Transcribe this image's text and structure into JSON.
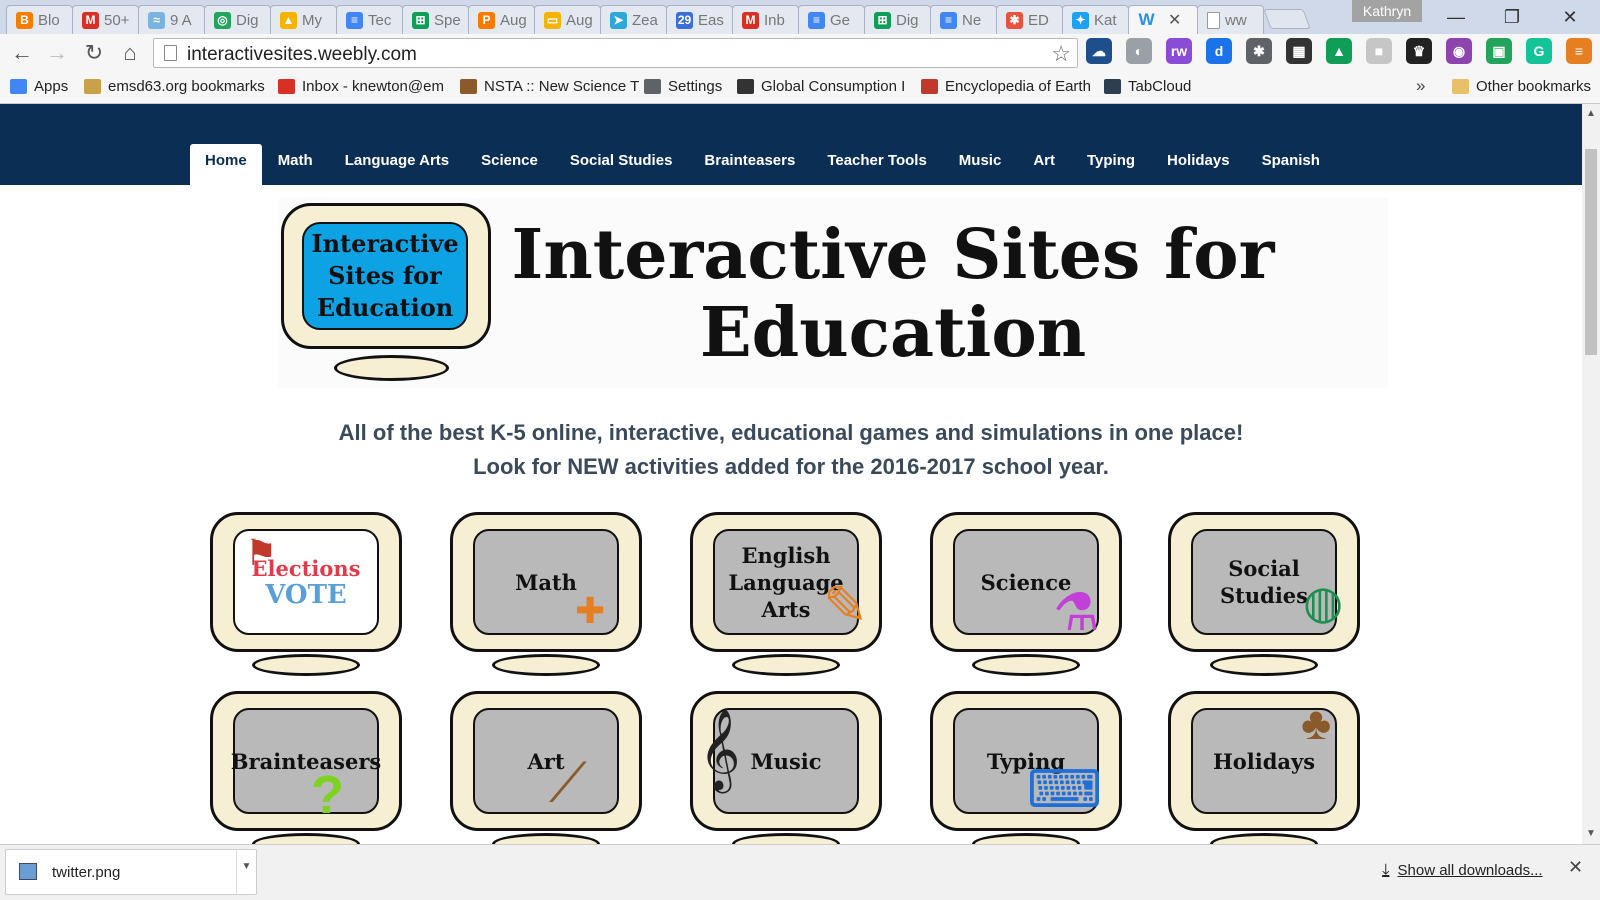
{
  "browser": {
    "tabs": [
      {
        "label": "Blo",
        "icon": "blogger-icon",
        "color": "#f57d00",
        "glyph": "B"
      },
      {
        "label": "50+",
        "icon": "gmail-icon",
        "color": "#d93025",
        "glyph": "M"
      },
      {
        "label": "9 A",
        "icon": "cloud-app-icon",
        "color": "#7ab3e0",
        "glyph": "≈"
      },
      {
        "label": "Dig",
        "icon": "classroom-icon",
        "color": "#22a45d",
        "glyph": "◎"
      },
      {
        "label": "My",
        "icon": "google-drive-icon",
        "color": "#f4b400",
        "glyph": "▲"
      },
      {
        "label": "Tec",
        "icon": "google-docs-icon",
        "color": "#4285f4",
        "glyph": "≡"
      },
      {
        "label": "Spe",
        "icon": "google-sheets-icon",
        "color": "#0f9d58",
        "glyph": "⊞"
      },
      {
        "label": "Aug",
        "icon": "p-app-icon",
        "color": "#f57c00",
        "glyph": "P"
      },
      {
        "label": "Aug",
        "icon": "google-slides-icon",
        "color": "#f4b400",
        "glyph": "▭"
      },
      {
        "label": "Zea",
        "icon": "zeal-icon",
        "color": "#2fa8d8",
        "glyph": "➤"
      },
      {
        "label": "Eas",
        "icon": "calendar-icon",
        "color": "#3b6fd8",
        "glyph": "29"
      },
      {
        "label": "Inb",
        "icon": "gmail-icon",
        "color": "#d93025",
        "glyph": "M"
      },
      {
        "label": "Ge",
        "icon": "google-docs-icon",
        "color": "#4285f4",
        "glyph": "≡"
      },
      {
        "label": "Dig",
        "icon": "google-sheets-icon",
        "color": "#0f9d58",
        "glyph": "⊞"
      },
      {
        "label": "Ne",
        "icon": "google-docs-icon",
        "color": "#4285f4",
        "glyph": "≡"
      },
      {
        "label": "ED",
        "icon": "edpuzzle-icon",
        "color": "#e8533f",
        "glyph": "✱"
      },
      {
        "label": "Kat",
        "icon": "twitter-icon",
        "color": "#1da1f2",
        "glyph": "✦"
      },
      {
        "label": "",
        "icon": "weebly-icon",
        "color": "#2990ea",
        "glyph": "W",
        "active": true
      },
      {
        "label": "ww",
        "icon": "blank-page-icon",
        "color": "#ffffff",
        "glyph": ""
      }
    ],
    "profile_name": "Kathryn",
    "window_controls": {
      "minimize": "—",
      "restore": "❐",
      "close": "✕"
    },
    "url": "interactivesites.weebly.com",
    "extensions": [
      {
        "icon": "onedrive-icon",
        "color": "#1f4e8c",
        "glyph": "☁"
      },
      {
        "icon": "web-clipper-icon",
        "color": "#9aa0a6",
        "glyph": "◐"
      },
      {
        "icon": "readwrite-icon",
        "color": "#8a4bd6",
        "glyph": "rw"
      },
      {
        "icon": "dictation-icon",
        "color": "#1a73e8",
        "glyph": "d"
      },
      {
        "icon": "lightbulb-icon",
        "color": "#5f6368",
        "glyph": "✱"
      },
      {
        "icon": "film-icon",
        "color": "#333333",
        "glyph": "▦"
      },
      {
        "icon": "google-drive-icon",
        "color": "#0f9d58",
        "glyph": "▲"
      },
      {
        "icon": "puzzle-icon",
        "color": "#c6c6c6",
        "glyph": "■"
      },
      {
        "icon": "crown-icon",
        "color": "#222222",
        "glyph": "♛"
      },
      {
        "icon": "podcast-icon",
        "color": "#8e44ad",
        "glyph": "◉"
      },
      {
        "icon": "classroom-icon",
        "color": "#22a45d",
        "glyph": "▣"
      },
      {
        "icon": "grammarly-icon",
        "color": "#15c39a",
        "glyph": "G"
      },
      {
        "icon": "menu-icon",
        "color": "#e67e22",
        "glyph": "≡"
      }
    ],
    "bookmarks": [
      {
        "label": "Apps",
        "icon": "apps-grid-icon",
        "color": "#4285f4"
      },
      {
        "label": "emsd63.org bookmarks",
        "icon": "folder-icon",
        "color": "#caa04a"
      },
      {
        "label": "Inbox - knewton@em",
        "icon": "gmail-icon",
        "color": "#d93025"
      },
      {
        "label": "NSTA :: New Science T",
        "icon": "nsta-icon",
        "color": "#8b5a2b"
      },
      {
        "label": "Settings",
        "icon": "gear-icon",
        "color": "#5f6368"
      },
      {
        "label": "Global Consumption I",
        "icon": "globe-grid-icon",
        "color": "#333333"
      },
      {
        "label": "Encyclopedia of Earth",
        "icon": "earth-icon",
        "color": "#c0392b"
      },
      {
        "label": "TabCloud",
        "icon": "cloud-icon",
        "color": "#2c3e50"
      }
    ],
    "bookmarks_overflow": "»",
    "other_bookmarks": "Other bookmarks"
  },
  "site": {
    "nav": [
      "Home",
      "Math",
      "Language Arts",
      "Science",
      "Social Studies",
      "Brainteasers",
      "Teacher Tools",
      "Music",
      "Art",
      "Typing",
      "Holidays",
      "Spanish"
    ],
    "active_nav": "Home",
    "logo_text": "Interactive Sites for Education",
    "banner_title": "Interactive Sites for Education",
    "tagline_line1": "All of the best K-5 online, interactive, educational games and simulations in one place!",
    "tagline_line2": "Look for NEW activities added for the 2016-2017 school year.",
    "tiles_row1": [
      {
        "label": "Elections",
        "sub": "VOTE",
        "icon": "us-flag-icon"
      },
      {
        "label": "Math",
        "icon": "math-symbols-icon"
      },
      {
        "label": "English Language Arts",
        "icon": "pencil-icon"
      },
      {
        "label": "Science",
        "icon": "flask-icon"
      },
      {
        "label": "Social Studies",
        "icon": "globe-icon"
      }
    ],
    "tiles_row2": [
      {
        "label": "Brainteasers",
        "icon": "question-mark-icon"
      },
      {
        "label": "Art",
        "icon": "paintbrush-icon"
      },
      {
        "label": "Music",
        "icon": "treble-clef-icon"
      },
      {
        "label": "Typing",
        "icon": "keyboard-icon"
      },
      {
        "label": "Holidays",
        "icon": "turkey-icon"
      }
    ]
  },
  "downloads": {
    "file": "twitter.png",
    "show_all": "Show all downloads..."
  }
}
